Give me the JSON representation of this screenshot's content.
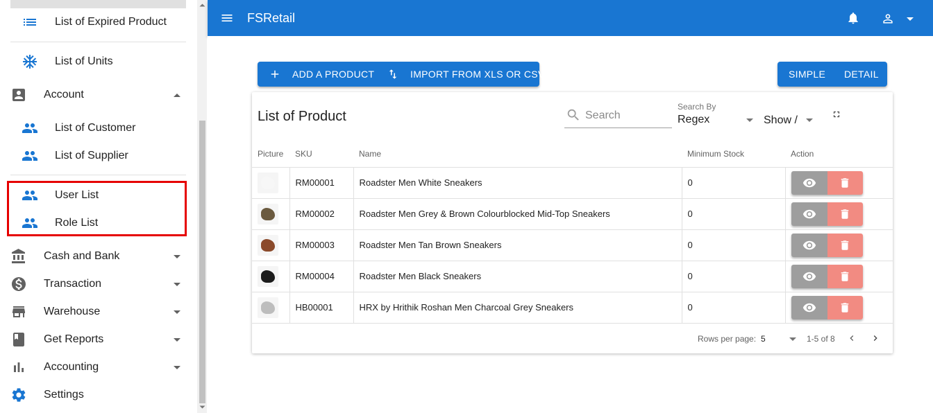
{
  "colors": {
    "primary": "#1976d2",
    "danger": "#f28b82",
    "neutral": "#9e9e9e",
    "highlight": "#e60000"
  },
  "sidebar": {
    "items": [
      {
        "label": "List of Expired Product",
        "icon": "list-icon"
      },
      {
        "label": "List of Units",
        "icon": "snowflake-icon"
      },
      {
        "label": "Account",
        "icon": "account-box-icon",
        "expanded": true
      },
      {
        "label": "List of Customer",
        "icon": "people-icon"
      },
      {
        "label": "List of Supplier",
        "icon": "people-icon"
      },
      {
        "label": "User List",
        "icon": "people-icon"
      },
      {
        "label": "Role List",
        "icon": "people-icon"
      },
      {
        "label": "Cash and Bank",
        "icon": "bank-icon"
      },
      {
        "label": "Transaction",
        "icon": "dollar-icon"
      },
      {
        "label": "Warehouse",
        "icon": "store-icon"
      },
      {
        "label": "Get Reports",
        "icon": "book-icon"
      },
      {
        "label": "Accounting",
        "icon": "bar-chart-icon"
      },
      {
        "label": "Settings",
        "icon": "gear-icon"
      }
    ]
  },
  "appbar": {
    "title": "FSRetail"
  },
  "actions": {
    "add_label": "ADD A PRODUCT",
    "import_label": "IMPORT FROM XLS OR CSV",
    "simple_label": "SIMPLE",
    "detail_label": "DETAIL"
  },
  "table_card": {
    "title": "List of Product",
    "search_placeholder": "Search",
    "search_by_caption": "Search By",
    "search_by_value": "Regex",
    "show_label": "Show /",
    "columns": [
      "Picture",
      "SKU",
      "Name",
      "Minimum Stock",
      "Action"
    ],
    "rows": [
      {
        "sku": "RM00001",
        "name": "Roadster Men White Sneakers",
        "min_stock": "0",
        "shoe_color": "#f7f7f7"
      },
      {
        "sku": "RM00002",
        "name": "Roadster Men Grey & Brown Colourblocked Mid-Top Sneakers",
        "min_stock": "0",
        "shoe_color": "#6b5a3f"
      },
      {
        "sku": "RM00003",
        "name": "Roadster Men Tan Brown Sneakers",
        "min_stock": "0",
        "shoe_color": "#8b4a2b"
      },
      {
        "sku": "RM00004",
        "name": "Roadster Men Black Sneakers",
        "min_stock": "0",
        "shoe_color": "#1c1c1c"
      },
      {
        "sku": "HB00001",
        "name": "HRX by Hrithik Roshan Men Charcoal Grey Sneakers",
        "min_stock": "0",
        "shoe_color": "#bdbdbd"
      }
    ],
    "footer": {
      "rows_per_page_label": "Rows per page:",
      "rows_per_page_value": "5",
      "range": "1-5 of 8"
    }
  }
}
